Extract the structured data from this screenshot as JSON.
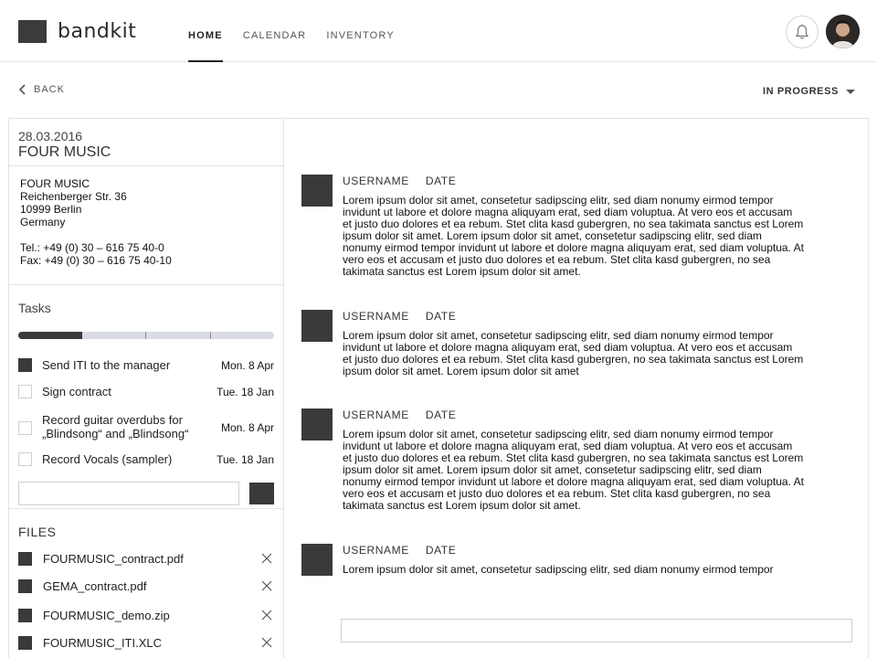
{
  "app": {
    "name": "bandkit"
  },
  "nav": [
    {
      "label": "HOME",
      "active": true
    },
    {
      "label": "CALENDAR",
      "active": false
    },
    {
      "label": "INVENTORY",
      "active": false
    }
  ],
  "toolbar": {
    "back_label": "BACK",
    "status": "IN PROGRESS"
  },
  "detail": {
    "date": "28.03.2016",
    "company": "FOUR MUSIC",
    "address": [
      "FOUR MUSIC",
      "Reichenberger Str. 36",
      "10999 Berlin",
      "Germany"
    ],
    "tel": "Tel.: +49 (0) 30 – 616 75 40-0",
    "fax": "Fax: +49 (0) 30 – 616 75 40-10"
  },
  "tasks": {
    "title": "Tasks",
    "progress": 0.25,
    "items": [
      {
        "label": "Send ITI to the manager",
        "date": "Mon. 8 Apr",
        "checked": true
      },
      {
        "label": "Sign contract",
        "date": "Tue. 18 Jan",
        "checked": false
      },
      {
        "label_lines": [
          "Record guitar overdubs for",
          "„Blindsong“ and „Blindsong“"
        ],
        "date": "Mon. 8 Apr",
        "checked": false
      },
      {
        "label": "Record Vocals (sampler)",
        "date": "Tue. 18 Jan",
        "checked": false
      }
    ],
    "new_task_value": ""
  },
  "files": {
    "title": "FILES",
    "items": [
      "FOURMUSIC_contract.pdf",
      "GEMA_contract.pdf",
      "FOURMUSIC_demo.zip",
      "FOURMUSIC_ITI.XLC"
    ]
  },
  "comments": [
    {
      "user": "USERNAME",
      "date": "DATE",
      "lines": [
        "Lorem ipsum dolor sit amet, consetetur sadipscing elitr, sed diam nonumy eirmod tempor",
        "invidunt ut labore et dolore magna aliquyam erat, sed diam voluptua. At vero eos et accusam",
        "et justo duo dolores et ea rebum. Stet clita kasd gubergren, no sea takimata sanctus est Lorem",
        "ipsum dolor sit amet. Lorem ipsum dolor sit amet, consetetur sadipscing elitr, sed diam",
        "nonumy eirmod tempor invidunt ut labore et dolore magna aliquyam erat, sed diam voluptua. At",
        "vero eos et accusam et justo duo dolores et ea rebum. Stet clita kasd gubergren, no sea",
        "takimata sanctus est Lorem ipsum dolor sit amet."
      ]
    },
    {
      "user": "USERNAME",
      "date": "DATE",
      "lines": [
        "Lorem ipsum dolor sit amet, consetetur sadipscing elitr, sed diam nonumy eirmod tempor",
        "invidunt ut labore et dolore magna aliquyam erat, sed diam voluptua. At vero eos et accusam",
        "et justo duo dolores et ea rebum. Stet clita kasd gubergren, no sea takimata sanctus est Lorem",
        "ipsum dolor sit amet. Lorem ipsum dolor sit amet"
      ]
    },
    {
      "user": "USERNAME",
      "date": "DATE",
      "lines": [
        "Lorem ipsum dolor sit amet, consetetur sadipscing elitr, sed diam nonumy eirmod tempor",
        "invidunt ut labore et dolore magna aliquyam erat, sed diam voluptua. At vero eos et accusam",
        "et justo duo dolores et ea rebum. Stet clita kasd gubergren, no sea takimata sanctus est Lorem",
        "ipsum dolor sit amet. Lorem ipsum dolor sit amet, consetetur sadipscing elitr, sed diam",
        "nonumy eirmod tempor invidunt ut labore et dolore magna aliquyam erat, sed diam voluptua. At",
        "vero eos et accusam et justo duo dolores et ea rebum. Stet clita kasd gubergren, no sea",
        "takimata sanctus est Lorem ipsum dolor sit amet."
      ]
    },
    {
      "user": "USERNAME",
      "date": "DATE",
      "lines": [
        "Lorem ipsum dolor sit amet, consetetur sadipscing elitr, sed diam nonumy eirmod tempor"
      ]
    }
  ],
  "reply_value": ""
}
